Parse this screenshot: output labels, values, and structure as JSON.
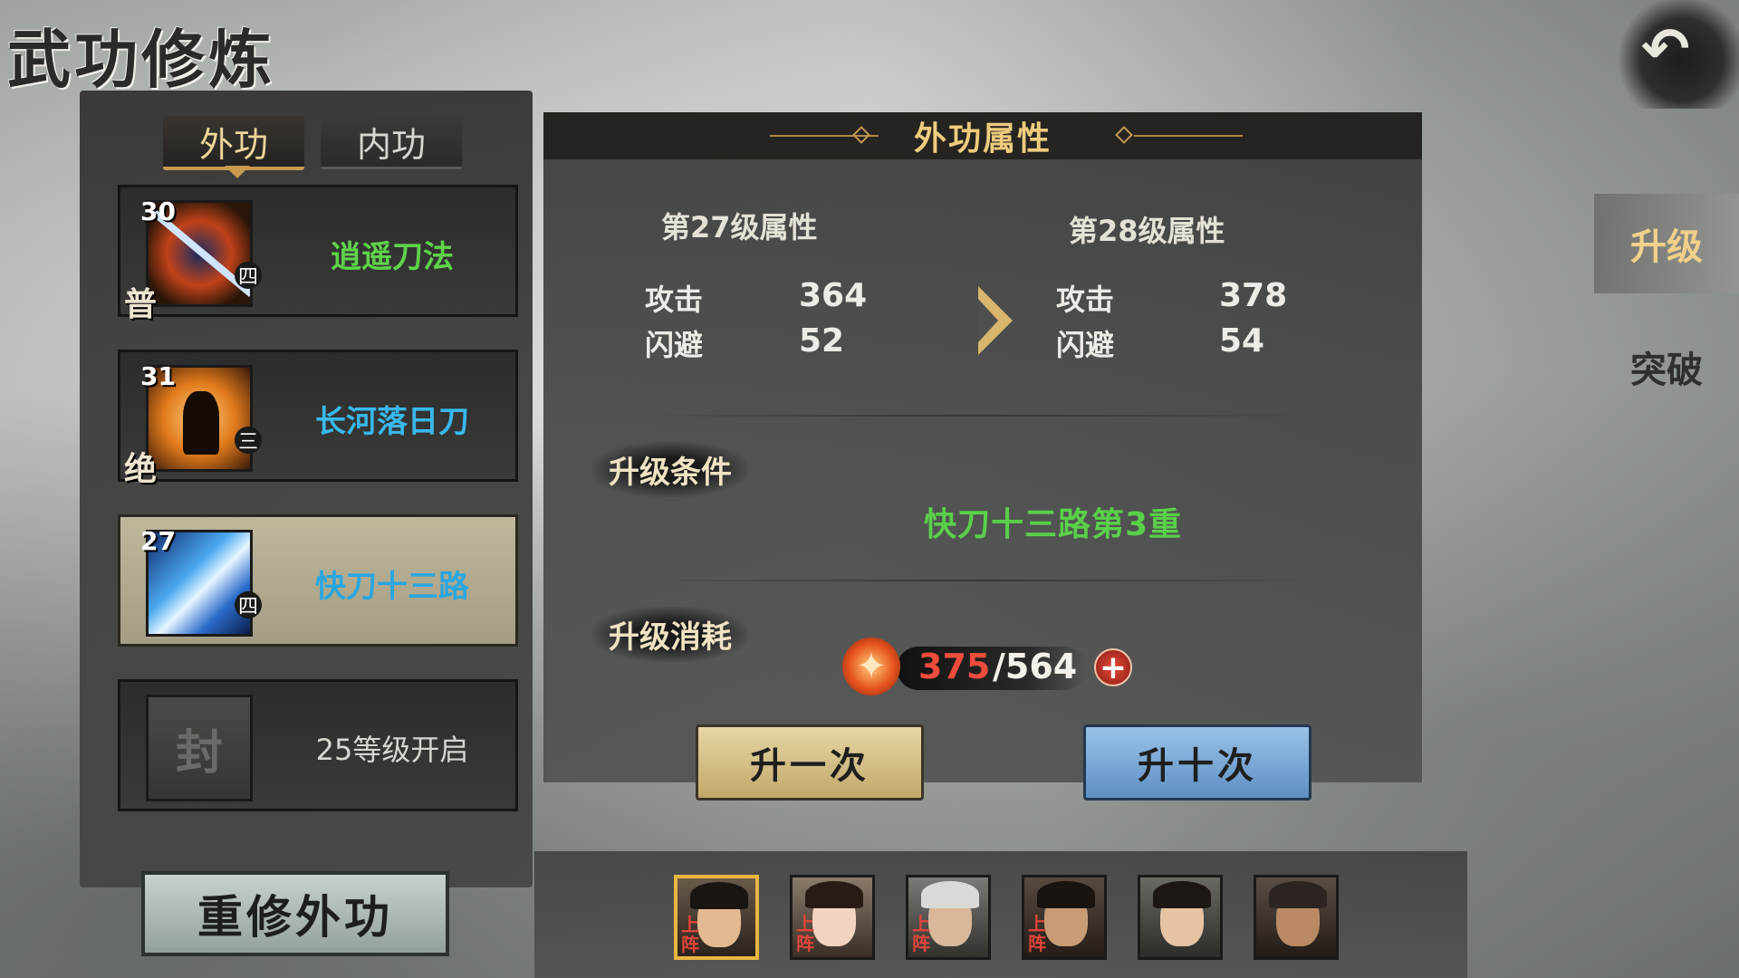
{
  "screen": {
    "title": "武功修炼",
    "back_icon": "back-arrow-icon"
  },
  "side_tabs": {
    "upgrade": "升级",
    "breakthrough": "突破"
  },
  "left": {
    "tabs": [
      {
        "label": "外功",
        "active": true
      },
      {
        "label": "内功",
        "active": false
      }
    ],
    "skills": [
      {
        "level": "30",
        "name": "逍遥刀法",
        "grade": "普",
        "tier": "四",
        "name_color": "#5fd34a",
        "selected": false
      },
      {
        "level": "31",
        "name": "长河落日刀",
        "grade": "绝",
        "tier": "三",
        "name_color": "#38b8ec",
        "selected": false
      },
      {
        "level": "27",
        "name": "快刀十三路",
        "grade": "",
        "tier": "四",
        "name_color": "#2aa6e0",
        "selected": true
      },
      {
        "level": "",
        "name": "25等级开启",
        "grade": "",
        "tier": "",
        "icon_text": "封",
        "name_color": "#d8d6cf",
        "locked": true
      }
    ],
    "rebuild_button": "重修外功"
  },
  "main": {
    "header": "外功属性",
    "current": {
      "title": "第27级属性",
      "stats": [
        {
          "label": "攻击",
          "value": "364"
        },
        {
          "label": "闪避",
          "value": "52"
        }
      ]
    },
    "next": {
      "title": "第28级属性",
      "stats": [
        {
          "label": "攻击",
          "value": "378"
        },
        {
          "label": "闪避",
          "value": "54"
        }
      ]
    },
    "condition_label": "升级条件",
    "condition_text": "快刀十三路第3重",
    "cost_label": "升级消耗",
    "cost": {
      "current": "375",
      "max": "/564"
    },
    "buttons": {
      "once": "升一次",
      "ten": "升十次"
    }
  },
  "heroes": [
    {
      "tag": "上阵",
      "selected": true,
      "skin": "#e3b98f",
      "hair": "#1b1511"
    },
    {
      "tag": "上阵",
      "selected": false,
      "skin": "#f2d3bf",
      "hair": "#2a1a14"
    },
    {
      "tag": "上阵",
      "selected": false,
      "skin": "#d8b79a",
      "hair": "#d9d9d6"
    },
    {
      "tag": "上阵",
      "selected": false,
      "skin": "#c99c75",
      "hair": "#1a1411"
    },
    {
      "tag": "",
      "selected": false,
      "skin": "#e6c3a2",
      "hair": "#1d1713"
    },
    {
      "tag": "",
      "selected": false,
      "skin": "#b98a63",
      "hair": "#2b2420"
    }
  ],
  "colors": {
    "accent_gold": "#efcc7e",
    "condition_green": "#5ad04a",
    "cost_red": "#ef4c3c"
  }
}
